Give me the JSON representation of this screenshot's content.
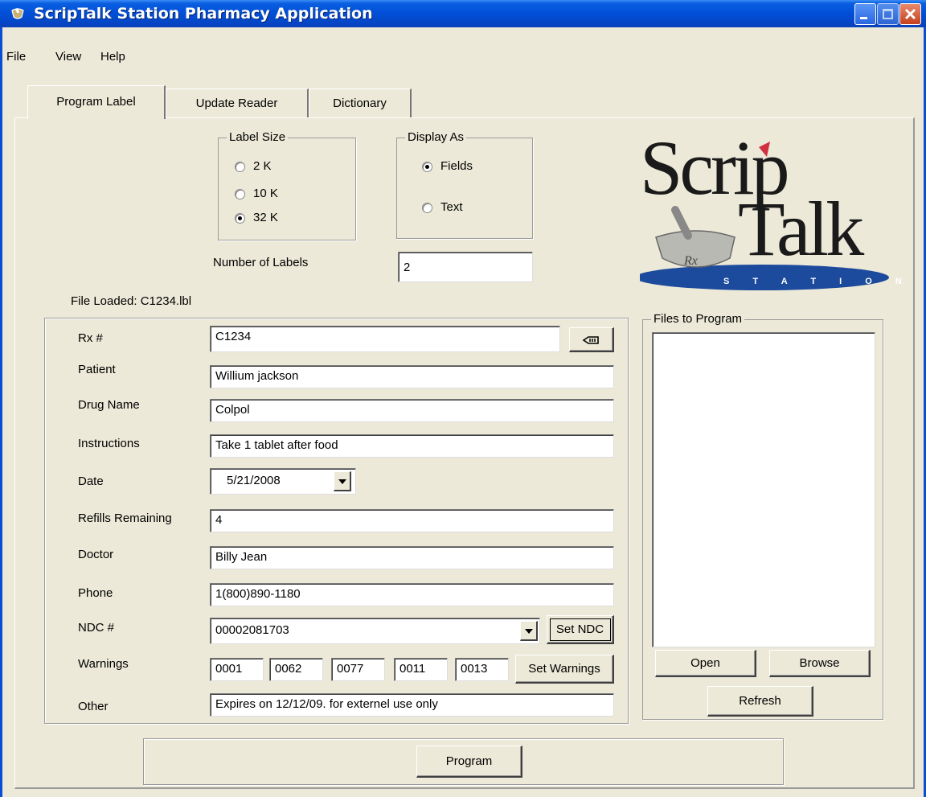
{
  "window": {
    "title": "ScripTalk Station Pharmacy Application"
  },
  "menu": {
    "file": "File",
    "view": "View",
    "help": "Help"
  },
  "tabs": [
    "Program Label",
    "Update Reader",
    "Dictionary"
  ],
  "label_size": {
    "legend": "Label Size",
    "options": [
      "2 K",
      "10 K",
      "32 K"
    ],
    "selected": "32 K"
  },
  "display_as": {
    "legend": "Display As",
    "options": [
      "Fields",
      "Text"
    ],
    "selected": "Fields"
  },
  "number_of_labels": {
    "label": "Number of Labels",
    "value": "2"
  },
  "file_loaded": "File Loaded: C1234.lbl",
  "logo": {
    "line1": "Scrip",
    "line2": "Talk",
    "badge": "S T A T I O N",
    "rx": "Rx"
  },
  "form": {
    "rx": {
      "label": "Rx #",
      "value": "C1234"
    },
    "patient": {
      "label": "Patient",
      "value": "Willium jackson"
    },
    "drug": {
      "label": "Drug Name",
      "value": "Colpol"
    },
    "instructions": {
      "label": "Instructions",
      "value": "Take 1 tablet after food"
    },
    "date": {
      "label": "Date",
      "value": "5/21/2008"
    },
    "refills": {
      "label": "Refills Remaining",
      "value": "4"
    },
    "doctor": {
      "label": "Doctor",
      "value": "Billy Jean"
    },
    "phone": {
      "label": "Phone",
      "value": "1(800)890-1180"
    },
    "ndc": {
      "label": "NDC #",
      "value": "00002081703",
      "button": "Set NDC"
    },
    "warnings": {
      "label": "Warnings",
      "codes": [
        "0001",
        "0062",
        "0077",
        "0011",
        "0013"
      ],
      "button": "Set Warnings"
    },
    "other": {
      "label": "Other",
      "value": "Expires on 12/12/09. for externel use only"
    }
  },
  "files": {
    "legend": "Files to Program",
    "open": "Open",
    "browse": "Browse",
    "refresh": "Refresh"
  },
  "program_button": "Program"
}
